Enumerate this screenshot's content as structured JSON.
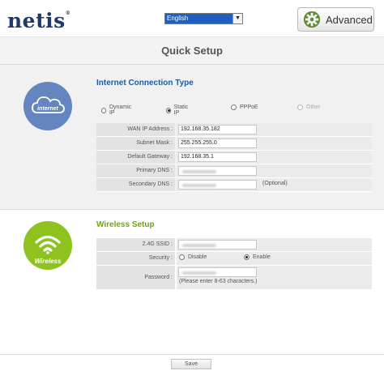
{
  "header": {
    "logo_text": "netis",
    "logo_tm": "®",
    "language": {
      "selected": "English",
      "arrow": "▼"
    },
    "advanced_label": "Advanced"
  },
  "page_title": "Quick Setup",
  "internet": {
    "badge_label": "internet",
    "title": "Internet Connection Type",
    "connection_types": [
      {
        "label": "Dynamic IP",
        "checked": false,
        "disabled": false
      },
      {
        "label": "Static IP",
        "checked": true,
        "disabled": false
      },
      {
        "label": "PPPoE",
        "checked": false,
        "disabled": false
      },
      {
        "label": "Other",
        "checked": false,
        "disabled": true
      }
    ],
    "fields": {
      "wan_ip_label": "WAN IP Address :",
      "wan_ip_value": "192.168.35.182",
      "subnet_label": "Subnet Mask :",
      "subnet_value": "255.255.255.0",
      "gateway_label": "Default Gateway :",
      "gateway_value": "192.168.35.1",
      "primary_dns_label": "Primary DNS :",
      "secondary_dns_label": "Secondary DNS :",
      "optional_note": "(Optional)"
    }
  },
  "wireless": {
    "badge_label": "Wireless",
    "title": "Wireless Setup",
    "ssid_label": "2.4G SSID :",
    "security_label": "Security :",
    "security_options": [
      {
        "label": "Disable",
        "checked": false
      },
      {
        "label": "Enable",
        "checked": true
      }
    ],
    "password_label": "Password :",
    "password_hint": "(Please enter 8-63 characters.)"
  },
  "footer": {
    "save_label": "Save"
  },
  "colors": {
    "brand_blue": "#1f3a6a",
    "internet_accent": "#6585c0",
    "wireless_accent": "#8dc21f",
    "title_blue": "#1f5aa0",
    "title_green": "#6ea51b"
  }
}
